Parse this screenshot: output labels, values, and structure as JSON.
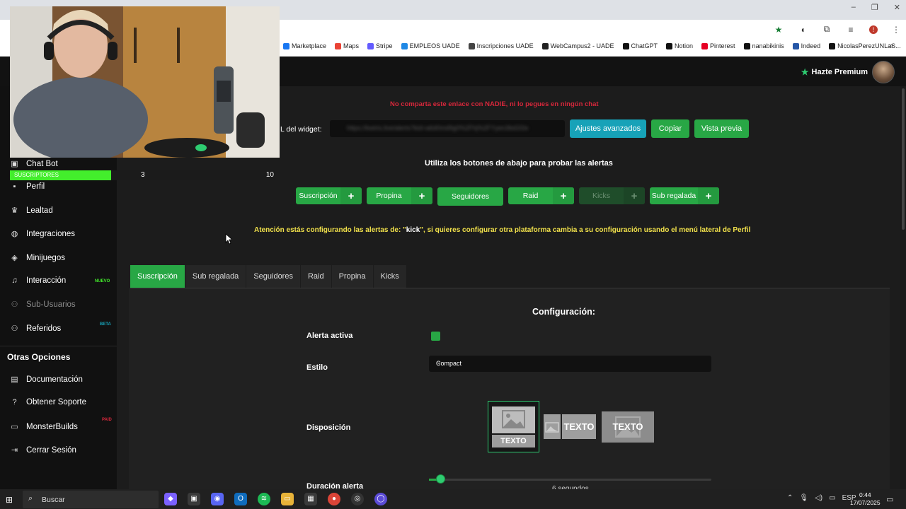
{
  "browser": {
    "bookmarks": [
      "Marketplace",
      "Maps",
      "Stripe",
      "EMPLEOS UADE",
      "Inscripciones UADE",
      "WebCampus2 - UADE",
      "ChatGPT",
      "Notion",
      "Pinterest",
      "nanabikinis",
      "Indeed",
      "NicolasPerezUNLaS..."
    ],
    "bookmarks_more": "»",
    "window_controls": [
      "–",
      "❐",
      "✕"
    ]
  },
  "header": {
    "premium_label": "Hazte Premium"
  },
  "webcam": {
    "progress_label": "SUSCRIPTORES",
    "progress_current": "3",
    "progress_max": "10",
    "progress_fraction": 0.3
  },
  "sidebar": {
    "items": [
      {
        "label": "Chat Bot",
        "icon": "robot-icon"
      },
      {
        "label": "Perfil",
        "icon": "user-icon"
      },
      {
        "label": "Lealtad",
        "icon": "trophy-icon"
      },
      {
        "label": "Integraciones",
        "icon": "database-icon"
      },
      {
        "label": "Minijuegos",
        "icon": "gamepad-icon"
      },
      {
        "label": "Interacción",
        "icon": "music-icon",
        "badge": "NUEVO"
      },
      {
        "label": "Sub-Usuarios",
        "icon": "users-icon"
      },
      {
        "label": "Referidos",
        "icon": "user-friends-icon",
        "badge": "BETA"
      }
    ],
    "other_title": "Otras Opciones",
    "other_items": [
      {
        "label": "Documentación",
        "icon": "book-icon"
      },
      {
        "label": "Obtener Soporte",
        "icon": "question-icon"
      },
      {
        "label": "MonsterBuilds",
        "icon": "laptop-icon",
        "badge": "PAID"
      },
      {
        "label": "Cerrar Sesión",
        "icon": "logout-icon"
      }
    ]
  },
  "main": {
    "warning": "No comparta este enlace con NADIE, ni lo pegues en ningún chat",
    "url_label": "L del widget:",
    "url_value": "https://kwiris.live/alerts?kid=a6d0md9g0%2Fhj%2FYyen3bd1f2e",
    "buttons": {
      "advanced": "Ajustes avanzados",
      "copy": "Copiar",
      "preview": "Vista previa"
    },
    "test_title": "Utiliza los botones de abajo para probar las alertas",
    "alert_buttons": [
      {
        "label": "Suscripción",
        "enabled": true
      },
      {
        "label": "Propina",
        "enabled": true
      },
      {
        "label": "Seguidores",
        "enabled": true
      },
      {
        "label": "Raid",
        "enabled": true
      },
      {
        "label": "Kicks",
        "enabled": false
      },
      {
        "label": "Sub regalada",
        "enabled": true
      }
    ],
    "plus": "+",
    "attention_pre": "Atención estás configurando las alertas de: \"",
    "attention_platform": "kick",
    "attention_post": "\", si quieres configurar otra plataforma cambia a su configuración usando el menú lateral de Perfil"
  },
  "tabs": [
    "Suscripción",
    "Sub regalada",
    "Seguidores",
    "Raid",
    "Propina",
    "Kicks"
  ],
  "config": {
    "title": "Configuración:",
    "active_label": "Alerta activa",
    "active_value": true,
    "style_label": "Estilo",
    "style_value": "Compact",
    "layout_label": "Disposición",
    "layout_text": "TEXTO",
    "duration_label": "Duración alerta",
    "duration_value": "6 segundos",
    "duration_fraction": 0.04
  },
  "taskbar": {
    "search_placeholder": "Buscar",
    "language": "ESP",
    "time": "0:44",
    "date": "17/07/2025"
  },
  "colors": {
    "accent_green": "#28a745",
    "teal": "#17a2b8",
    "warning_red": "#d6273b",
    "attention_yellow": "#f1e14b",
    "progress_green": "#43ee2c"
  }
}
